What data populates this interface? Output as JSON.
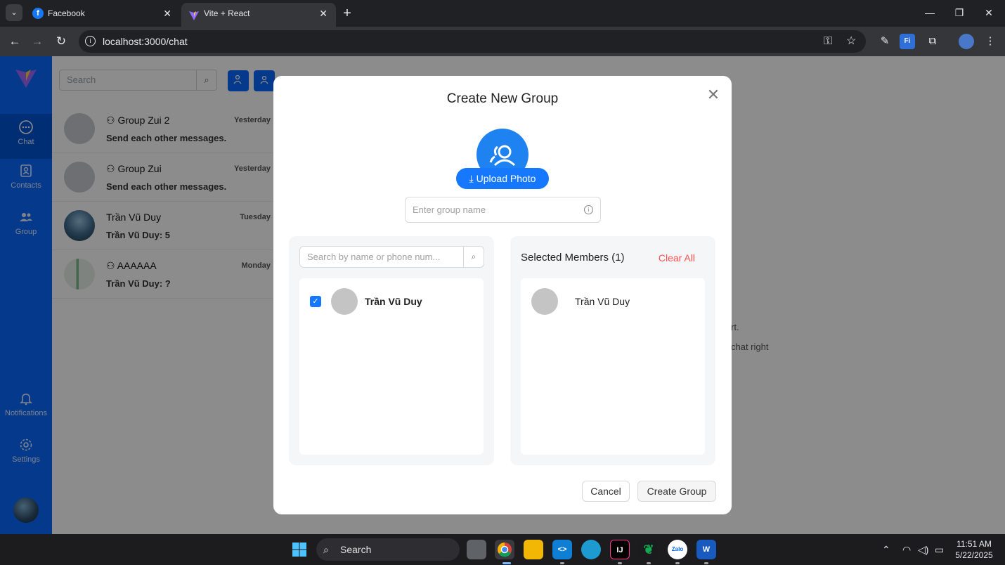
{
  "browser": {
    "tabs": [
      {
        "label": "Facebook",
        "favicon": "facebook-icon",
        "color": "#1877f2"
      },
      {
        "label": "Vite + React",
        "favicon": "vite-icon",
        "active": true
      }
    ],
    "url": "localhost:3000/chat"
  },
  "rail": {
    "items": [
      {
        "label": "Chat",
        "icon": "chat-icon",
        "active": true
      },
      {
        "label": "Contacts",
        "icon": "contacts-icon"
      },
      {
        "label": "Group",
        "icon": "group-icon"
      },
      {
        "label": "Notifications",
        "icon": "bell-icon"
      },
      {
        "label": "Settings",
        "icon": "gear-icon"
      }
    ],
    "accent": "#0a68ff"
  },
  "list": {
    "search_placeholder": "Search",
    "conversations": [
      {
        "name": "Group Zui 2",
        "last": "Send each other messages.",
        "time": "Yesterday",
        "group": true
      },
      {
        "name": "Group Zui",
        "last": "Send each other messages.",
        "time": "Yesterday",
        "group": true
      },
      {
        "name": "Trần Vũ Duy",
        "last": "Trần Vũ Duy: 5",
        "time": "Tuesday",
        "group": false
      },
      {
        "name": "AAAAAA",
        "last": "Trần Vũ Duy: ?",
        "time": "Monday",
        "group": true
      }
    ]
  },
  "background_text": {
    "line1": "rt.",
    "line2": "chat right"
  },
  "modal": {
    "title": "Create New Group",
    "upload_label": "Upload Photo",
    "group_name_placeholder": "Enter group name",
    "member_search_placeholder": "Search by name or phone num...",
    "members": [
      {
        "name": "Trần Vũ Duy",
        "checked": true
      }
    ],
    "selected_title": "Selected Members (1)",
    "clear_all": "Clear All",
    "selected": [
      {
        "name": "Trần Vũ Duy"
      }
    ],
    "cancel_label": "Cancel",
    "create_label": "Create Group"
  },
  "taskbar": {
    "search_label": "Search",
    "time": "11:51 AM",
    "date": "5/22/2025"
  }
}
